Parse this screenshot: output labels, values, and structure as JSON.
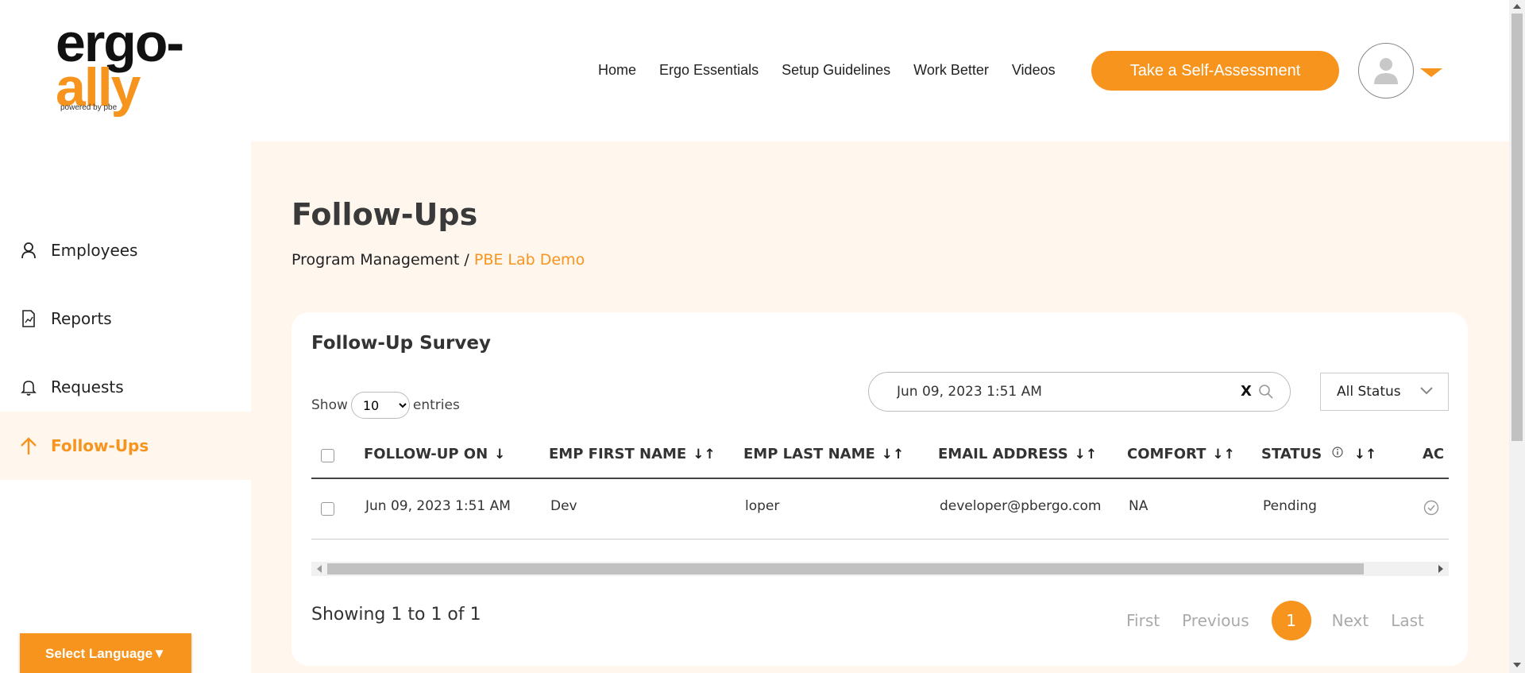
{
  "brand": {
    "logo_line1": "ergo-",
    "logo_line2": "ally",
    "logo_tagline": "powered by pbe"
  },
  "nav": [
    {
      "label": "Home"
    },
    {
      "label": "Ergo Essentials"
    },
    {
      "label": "Setup Guidelines"
    },
    {
      "label": "Work Better"
    },
    {
      "label": "Videos"
    }
  ],
  "header": {
    "cta_label": "Take a Self-Assessment"
  },
  "sidebar": {
    "items": [
      {
        "label": "Employees",
        "icon": "person-icon"
      },
      {
        "label": "Reports",
        "icon": "report-icon"
      },
      {
        "label": "Requests",
        "icon": "bell-icon"
      },
      {
        "label": "Follow-Ups",
        "icon": "arrow-up-icon",
        "active": true
      }
    ],
    "language_label": "Select Language▼"
  },
  "page": {
    "title": "Follow-Ups",
    "breadcrumb_parent": "Program Management",
    "breadcrumb_sep": "/",
    "breadcrumb_current": "PBE Lab Demo"
  },
  "survey": {
    "title": "Follow-Up Survey",
    "show_prefix": "Show",
    "show_value": "10",
    "show_suffix": "entries",
    "search_value": "Jun 09, 2023 1:51 AM",
    "search_clear": "X",
    "status_filter": "All Status",
    "columns": [
      "FOLLOW-UP ON",
      "EMP FIRST NAME",
      "EMP LAST NAME",
      "EMAIL ADDRESS",
      "COMFORT",
      "STATUS",
      "AC"
    ],
    "rows": [
      {
        "follow_up_on": "Jun 09, 2023 1:51 AM",
        "first_name": "Dev",
        "last_name": "loper",
        "email": "developer@pbergo.com",
        "comfort": "NA",
        "status": "Pending"
      }
    ],
    "showing": "Showing 1 to 1 of 1",
    "pager": {
      "first": "First",
      "previous": "Previous",
      "current": "1",
      "next": "Next",
      "last": "Last"
    }
  },
  "colors": {
    "accent": "#f7941d",
    "main_bg": "#fff6ee"
  }
}
